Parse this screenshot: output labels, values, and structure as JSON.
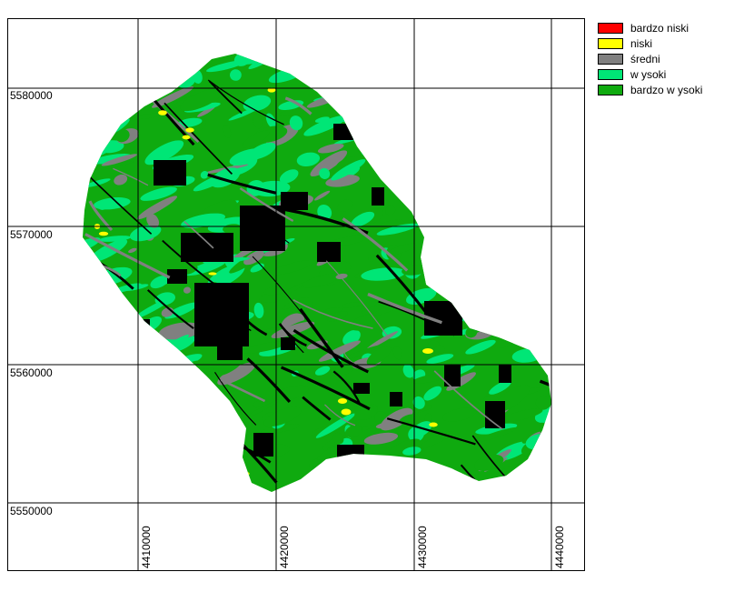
{
  "map": {
    "y_ticks": [
      "5580000",
      "5570000",
      "5560000",
      "5550000"
    ],
    "x_ticks": [
      "4410000",
      "4420000",
      "4430000",
      "4440000"
    ],
    "colors": {
      "background": "#ffffff",
      "grid": "#000000",
      "no_data": "#000000",
      "bardzo_niski": "#ff0000",
      "niski": "#ffff00",
      "sredni": "#808080",
      "wysoki": "#00e676",
      "bardzo_wysoki": "#0faa0f"
    }
  },
  "legend": {
    "items": [
      {
        "label": "bardzo niski",
        "color": "#ff0000"
      },
      {
        "label": "niski",
        "color": "#ffff00"
      },
      {
        "label": "średni",
        "color": "#808080"
      },
      {
        "label": "w ysoki",
        "color": "#00e676"
      },
      {
        "label": "bardzo w ysoki",
        "color": "#0faa0f"
      }
    ]
  }
}
